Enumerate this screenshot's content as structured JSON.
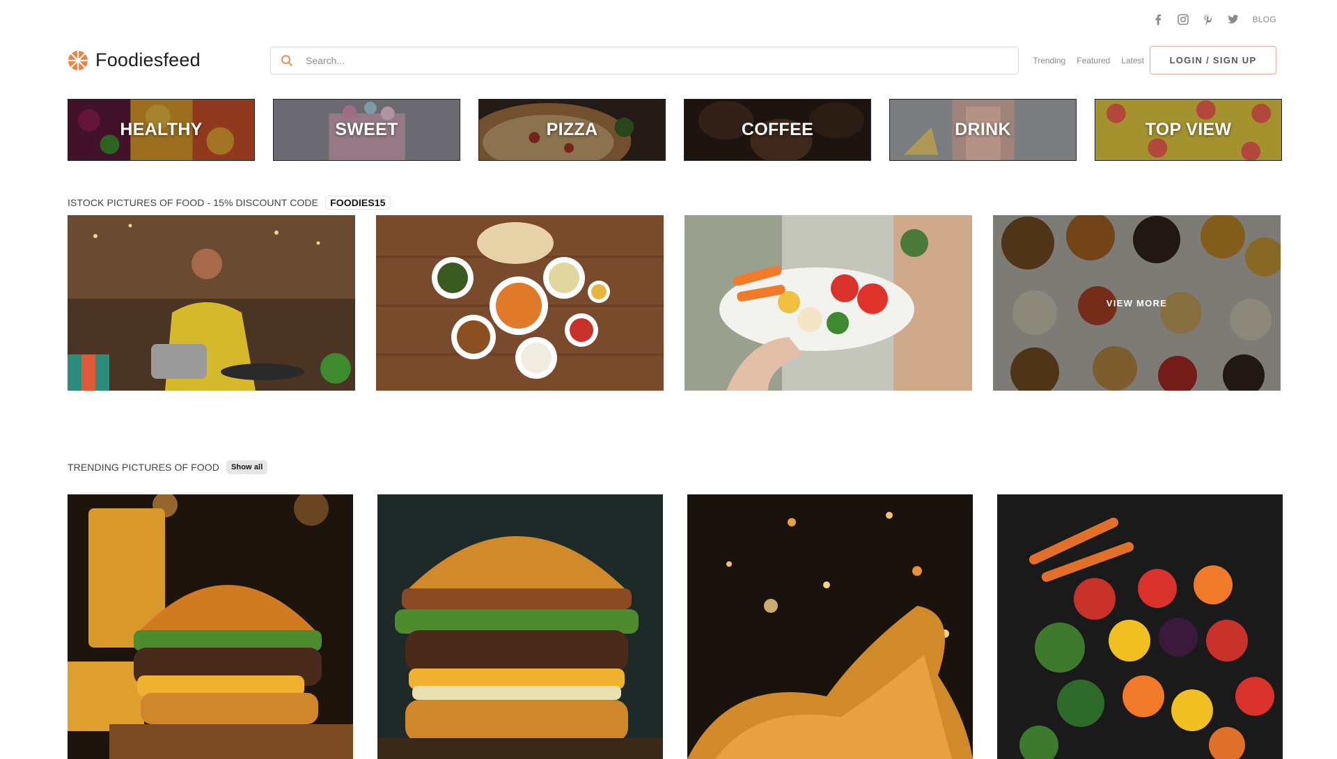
{
  "topbar": {
    "social_icons": [
      "facebook-icon",
      "instagram-icon",
      "pinterest-icon",
      "twitter-icon"
    ],
    "blog_label": "BLOG"
  },
  "header": {
    "brand": "Foodiesfeed",
    "search_placeholder": "Search...",
    "nav": [
      "Trending",
      "Featured",
      "Latest"
    ],
    "login_label": "LOGIN / SIGN UP"
  },
  "categories": [
    {
      "label": "HEALTHY"
    },
    {
      "label": "SWEET"
    },
    {
      "label": "PIZZA"
    },
    {
      "label": "COFFEE"
    },
    {
      "label": "DRINK"
    },
    {
      "label": "TOP VIEW"
    }
  ],
  "istock": {
    "title": "ISTOCK PICTURES OF FOOD - 15% DISCOUNT CODE",
    "code": "FOODIES15",
    "view_more_label": "VIEW MORE"
  },
  "trending": {
    "title": "TRENDING PICTURES OF FOOD",
    "show_all_label": "Show all"
  },
  "colors": {
    "accent": "#e8a79b",
    "logo_orange": "#f0803c"
  }
}
